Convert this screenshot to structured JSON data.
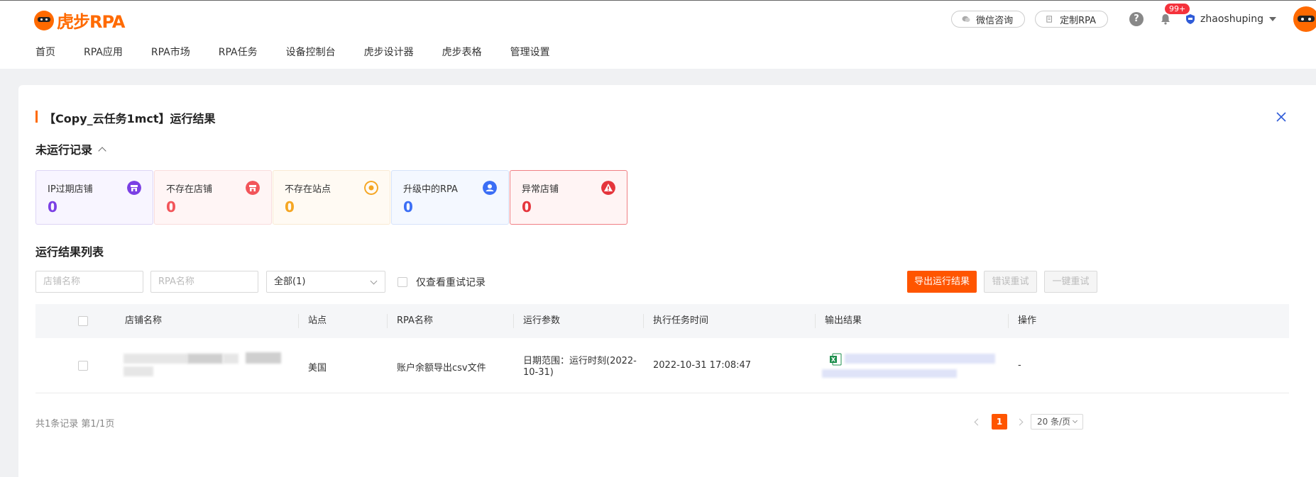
{
  "brand": {
    "logo_text": "虎步",
    "logo_suffix": "RPA"
  },
  "header": {
    "wechat_label": "微信咨询",
    "custom_label": "定制RPA",
    "help_label": "?",
    "notification_badge": "99+",
    "username": "zhaoshuping"
  },
  "nav": {
    "items": [
      {
        "label": "首页"
      },
      {
        "label": "RPA应用"
      },
      {
        "label": "RPA市场"
      },
      {
        "label": "RPA任务"
      },
      {
        "label": "设备控制台"
      },
      {
        "label": "虎步设计器"
      },
      {
        "label": "虎步表格"
      },
      {
        "label": "管理设置"
      }
    ]
  },
  "panel": {
    "title": "【Copy_云任务1mct】运行结果",
    "not_run_section": "未运行记录",
    "stats": [
      {
        "label": "IP过期店铺",
        "value": "0",
        "color": "#7b3fe4",
        "bg": "#f8f5ff",
        "border": "#ded5f5",
        "icon": "store-icon"
      },
      {
        "label": "不存在店铺",
        "value": "0",
        "color": "#f2555a",
        "bg": "#fff5f5",
        "border": "#f9dcdc",
        "icon": "store-icon"
      },
      {
        "label": "不存在站点",
        "value": "0",
        "color": "#f5a623",
        "bg": "#fffaf3",
        "border": "#f9ead3",
        "icon": "site-icon"
      },
      {
        "label": "升级中的RPA",
        "value": "0",
        "color": "#3b6ef5",
        "bg": "#f4f8ff",
        "border": "#d6e3fa",
        "icon": "rpa-icon"
      },
      {
        "label": "异常店铺",
        "value": "0",
        "color": "#e5353c",
        "bg": "#fff4f4",
        "border": "#f07f84",
        "icon": "warning-icon"
      }
    ],
    "results_section": "运行结果列表"
  },
  "filters": {
    "shop_placeholder": "店铺名称",
    "rpa_placeholder": "RPA名称",
    "status_selected": "全部(1)",
    "retry_only_label": "仅查看重试记录",
    "export_label": "导出运行结果",
    "error_retry_label": "错误重试",
    "one_click_retry_label": "一键重试"
  },
  "table": {
    "columns": [
      "店铺名称",
      "站点",
      "RPA名称",
      "运行参数",
      "执行任务时间",
      "输出结果",
      "操作"
    ],
    "rows": [
      {
        "site": "美国",
        "rpa_name": "账户余额导出csv文件",
        "params_line1": "日期范围：运行时刻(2022-",
        "params_line2": "10-31)",
        "exec_time": "2022-10-31 17:08:47",
        "action": "-"
      }
    ]
  },
  "footer": {
    "summary": "共1条记录 第1/1页",
    "current_page": "1",
    "page_size": "20 条/页"
  }
}
